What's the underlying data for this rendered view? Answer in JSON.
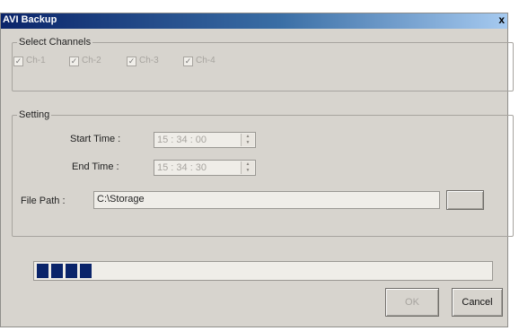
{
  "window": {
    "title": "AVI Backup",
    "close_glyph": "x"
  },
  "channels": {
    "legend": "Select Channels",
    "items": [
      {
        "label": "Ch-1",
        "checked": true
      },
      {
        "label": "Ch-2",
        "checked": true
      },
      {
        "label": "Ch-3",
        "checked": true
      },
      {
        "label": "Ch-4",
        "checked": true
      }
    ]
  },
  "setting": {
    "legend": "Setting",
    "start_label": "Start Time :",
    "start_value": "15 : 34 : 00",
    "end_label": "End Time :",
    "end_value": "15 : 34 : 30",
    "path_label": "File Path :",
    "path_value": "C:\\Storage",
    "browse_label": ""
  },
  "progress": {
    "segments": 4
  },
  "buttons": {
    "ok": "OK",
    "cancel": "Cancel"
  },
  "icons": {
    "spin": "spin-updown-icon",
    "check": "checkmark-icon"
  },
  "colors": {
    "title_bar": "#0a246a",
    "progress_fill": "#0a246a",
    "dialog_bg": "#d7d4ce"
  }
}
